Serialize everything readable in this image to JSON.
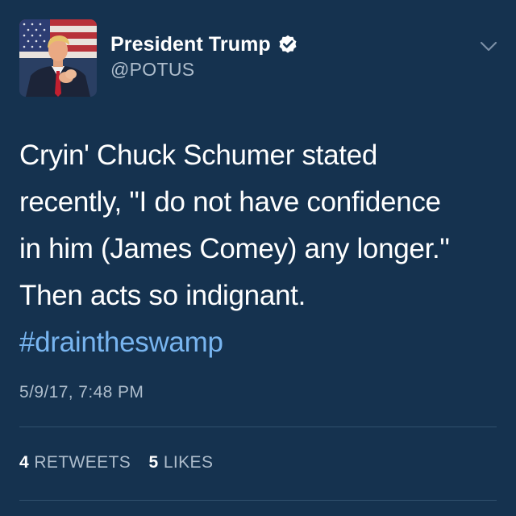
{
  "user": {
    "display_name": "President Trump",
    "handle": "@POTUS",
    "verified": true,
    "avatar": "profile-photo"
  },
  "tweet": {
    "lines": [
      "Cryin' Chuck Schumer stated",
      "recently, \"I do not have confidence",
      "in him (James Comey) any longer.\"",
      "Then acts so indignant."
    ],
    "hashtag": "#draintheswamp",
    "timestamp": "5/9/17, 7:48 PM"
  },
  "stats": {
    "retweets_count": "4",
    "retweets_label": "RETWEETS",
    "likes_count": "5",
    "likes_label": "LIKES"
  },
  "icons": {
    "verified": "verified-badge-icon",
    "menu": "chevron-down-icon"
  },
  "colors": {
    "background": "#15324f",
    "text": "#ffffff",
    "secondary_text": "#aebdcc",
    "hashtag": "#78b5f0",
    "divider": "#30506e"
  }
}
